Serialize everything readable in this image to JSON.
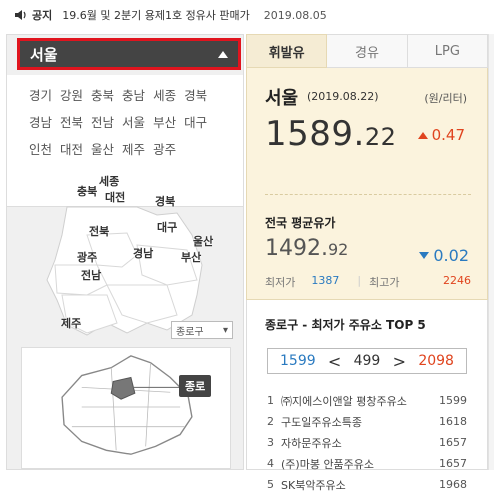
{
  "notice": {
    "tag": "공지",
    "message": "19.6월 및 2분기 용제1호 정유사 판매가",
    "date": "2019.08.05"
  },
  "region": {
    "selected": "서울",
    "rows": [
      [
        "경기",
        "강원",
        "충북",
        "충남",
        "세종",
        "경북"
      ],
      [
        "경남",
        "전북",
        "전남",
        "서울",
        "부산",
        "대구"
      ],
      [
        "인천",
        "대전",
        "울산",
        "제주",
        "광주"
      ]
    ]
  },
  "map_labels": {
    "sejong": "세종",
    "chungbuk": "충북",
    "daejeon": "대전",
    "gyeongbuk": "경북",
    "jeonbuk": "전북",
    "daegu": "대구",
    "ulsan": "울산",
    "gyeongnam": "경남",
    "gwangju": "광주",
    "busan": "부산",
    "jeonnam": "전남",
    "jeju": "제주"
  },
  "district_select": "종로구",
  "seoul_callout": "종로",
  "tabs": [
    "휘발유",
    "경유",
    "LPG"
  ],
  "price": {
    "city": "서울",
    "date": "(2019.08.22)",
    "unit": "(원/리터)",
    "value_main": "1589.",
    "value_decimal": "22",
    "change": "0.47"
  },
  "national": {
    "title": "전국 평균유가",
    "value_main": "1492.",
    "value_decimal": "92",
    "change": "0.02",
    "min_label": "최저가",
    "min_value": "1387",
    "max_label": "최고가",
    "max_value": "2246"
  },
  "top5": {
    "title": "종로구 - 최저가 주유소 TOP 5",
    "pager_low": "1599",
    "pager_mid": "499",
    "pager_high": "2098",
    "items": [
      {
        "rank": "1",
        "name": "㈜지에스이앤알 평창주유소",
        "price": "1599"
      },
      {
        "rank": "2",
        "name": "구도일주유소특종",
        "price": "1618"
      },
      {
        "rank": "3",
        "name": "자하문주유소",
        "price": "1657"
      },
      {
        "rank": "4",
        "name": "(주)마봉 안품주유소",
        "price": "1657"
      },
      {
        "rank": "5",
        "name": "SK북악주유소",
        "price": "1968"
      }
    ]
  },
  "colors": {
    "accent_red": "#e0141e",
    "up": "#e0441e",
    "down": "#2a7ac0",
    "panel": "#fbf3dd"
  }
}
